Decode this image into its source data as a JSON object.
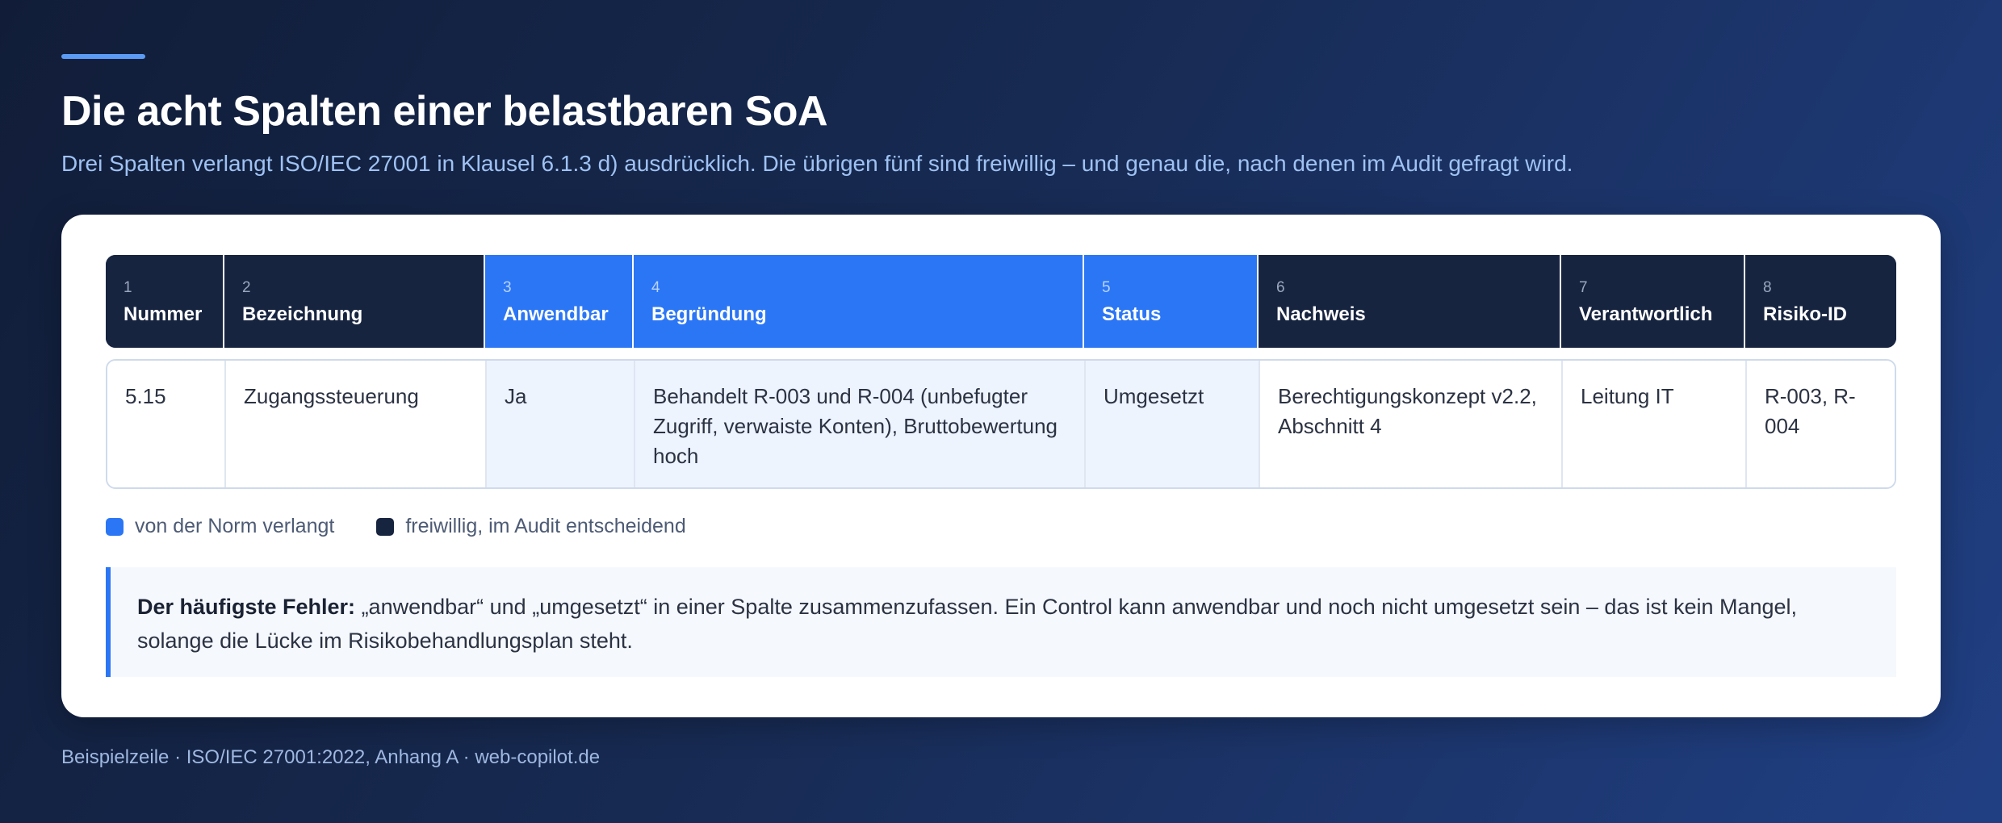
{
  "colors": {
    "required": "#2b76f5",
    "optional": "#172440",
    "accent": "#5b9bf5"
  },
  "header": {
    "title": "Die acht Spalten einer belastbaren SoA",
    "subtitle": "Drei Spalten verlangt ISO/IEC 27001 in Klausel 6.1.3 d) ausdrücklich. Die übrigen fünf sind freiwillig – und genau die, nach denen im Audit gefragt wird."
  },
  "table": {
    "columns": [
      {
        "num": "1",
        "label": "Nummer",
        "required": false
      },
      {
        "num": "2",
        "label": "Bezeichnung",
        "required": false
      },
      {
        "num": "3",
        "label": "Anwendbar",
        "required": true
      },
      {
        "num": "4",
        "label": "Begründung",
        "required": true
      },
      {
        "num": "5",
        "label": "Status",
        "required": true
      },
      {
        "num": "6",
        "label": "Nachweis",
        "required": false
      },
      {
        "num": "7",
        "label": "Verantwortlich",
        "required": false
      },
      {
        "num": "8",
        "label": "Risiko-ID",
        "required": false
      }
    ],
    "row": [
      "5.15",
      "Zugangssteuerung",
      "Ja",
      "Behandelt R-003 und R-004 (unbefugter Zugriff, verwaiste Konten), Bruttobewertung hoch",
      "Umgesetzt",
      "Berechtigungskonzept v2.2, Abschnitt 4",
      "Leitung IT",
      "R-003, R-004"
    ]
  },
  "legend": {
    "required_label": "von der Norm verlangt",
    "optional_label": "freiwillig, im Audit entscheidend"
  },
  "note": {
    "strong": "Der häufigste Fehler:",
    "text": " „anwendbar“ und „umgesetzt“ in einer Spalte zusammenzufassen. Ein Control kann anwendbar und noch nicht umgesetzt sein – das ist kein Mangel, solange die Lücke im Risikobehandlungsplan steht."
  },
  "footer": {
    "text": "Beispielzeile · ISO/IEC 27001:2022, Anhang A · web-copilot.de"
  }
}
